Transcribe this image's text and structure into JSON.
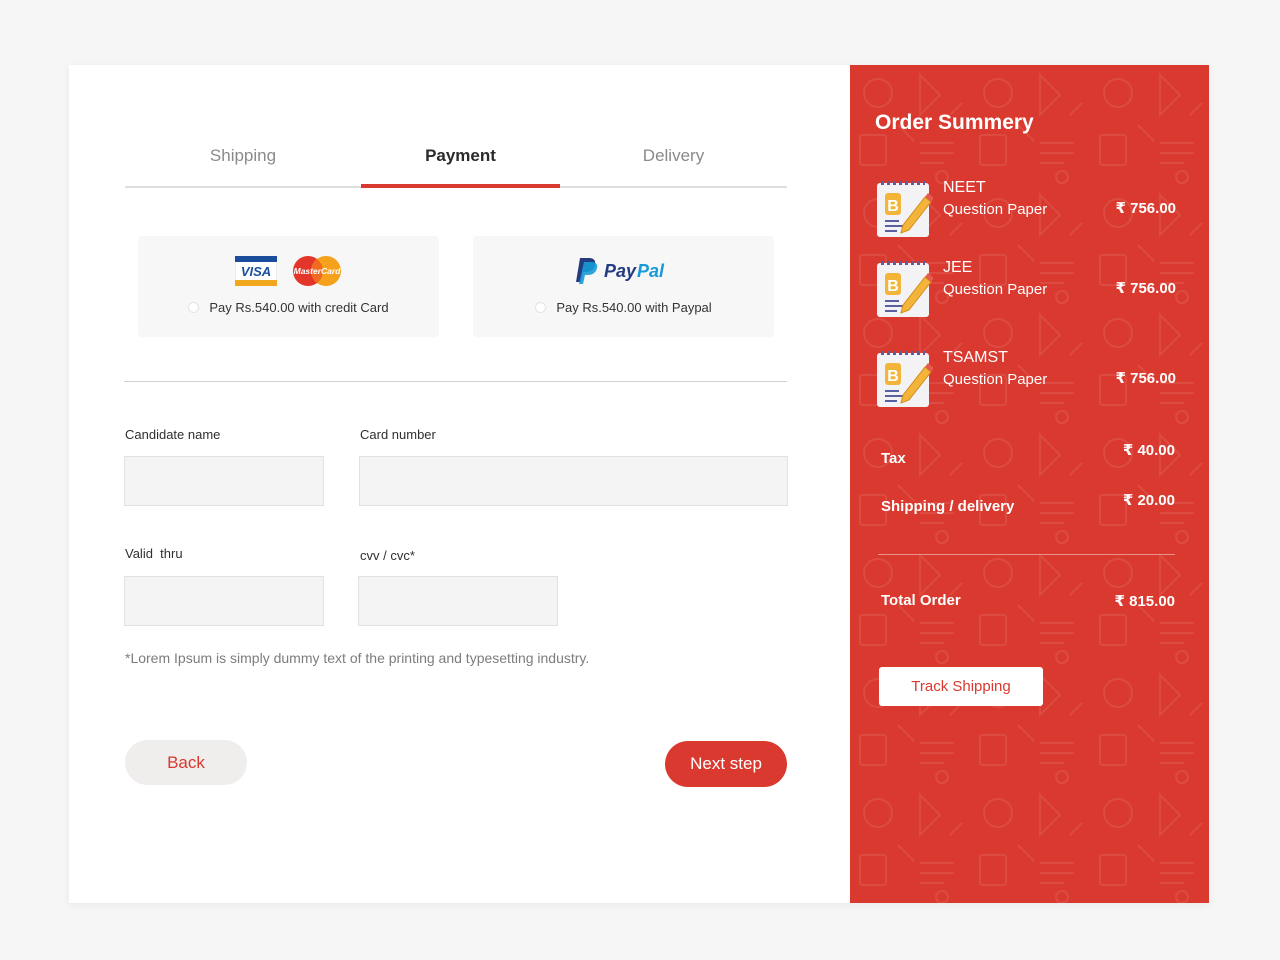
{
  "tabs": [
    {
      "label": "Shipping"
    },
    {
      "label": "Payment"
    },
    {
      "label": "Delivery"
    }
  ],
  "payment_options": {
    "card": {
      "text": "Pay Rs.540.00 with credit Card",
      "visa": "VISA",
      "mastercard": "MasterCard"
    },
    "paypal": {
      "text": "Pay Rs.540.00 with Paypal",
      "brand_pay": "Pay",
      "brand_pal": "Pal"
    }
  },
  "form": {
    "candidate_name_label": "Candidate name",
    "card_number_label": "Card number",
    "valid_thru_label": "Valid  thru",
    "cvv_label": "cvv / cvc*",
    "note": "*Lorem Ipsum is simply dummy text of the printing and typesetting industry."
  },
  "buttons": {
    "back": "Back",
    "next": "Next step",
    "track": "Track Shipping"
  },
  "summary": {
    "title": "Order Summery",
    "items": [
      {
        "name": "NEET",
        "sub": "Question Paper",
        "price": "₹ 756.00"
      },
      {
        "name": "JEE",
        "sub": "Question Paper",
        "price": "₹ 756.00"
      },
      {
        "name": "TSAMST",
        "sub": "Question Paper",
        "price": "₹ 756.00"
      }
    ],
    "tax_label": "Tax",
    "tax_value": "₹ 40.00",
    "shipping_label": "Shipping / delivery",
    "shipping_value": "₹ 20.00",
    "total_label": "Total Order",
    "total_value": "₹ 815.00"
  },
  "colors": {
    "accent": "#d9392e",
    "background": "#f6f6f6",
    "field_bg": "#f4f4f4"
  }
}
